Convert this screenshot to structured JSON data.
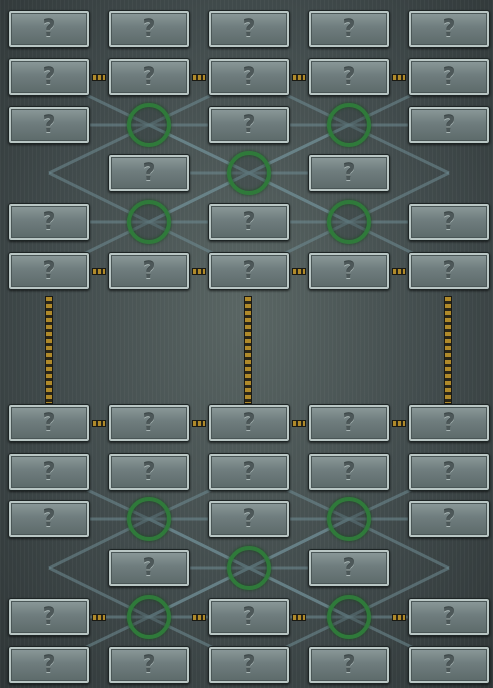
{
  "tile_glyph": "?",
  "colors": {
    "ring": "#2f7a3a",
    "tile": "#7b8889",
    "connector": "#b08a2a",
    "background": "#414b4c"
  },
  "grid": {
    "columns": 5,
    "top_rows": 6,
    "bottom_rows": 6,
    "hidden_tiles": [
      [
        2,
        1
      ],
      [
        2,
        3
      ],
      [
        4,
        1
      ],
      [
        4,
        3
      ],
      [
        8,
        1
      ],
      [
        8,
        3
      ],
      [
        10,
        1
      ],
      [
        10,
        3
      ],
      [
        3,
        0
      ],
      [
        3,
        2
      ],
      [
        3,
        4
      ],
      [
        9,
        0
      ],
      [
        9,
        2
      ],
      [
        9,
        4
      ]
    ]
  },
  "rings": [
    {
      "row": 2,
      "col": 1
    },
    {
      "row": 2,
      "col": 3
    },
    {
      "row": 3,
      "col": 2
    },
    {
      "row": 4,
      "col": 1
    },
    {
      "row": 4,
      "col": 3
    },
    {
      "row": 8,
      "col": 1
    },
    {
      "row": 8,
      "col": 3
    },
    {
      "row": 9,
      "col": 2
    },
    {
      "row": 10,
      "col": 1
    },
    {
      "row": 10,
      "col": 3
    }
  ]
}
